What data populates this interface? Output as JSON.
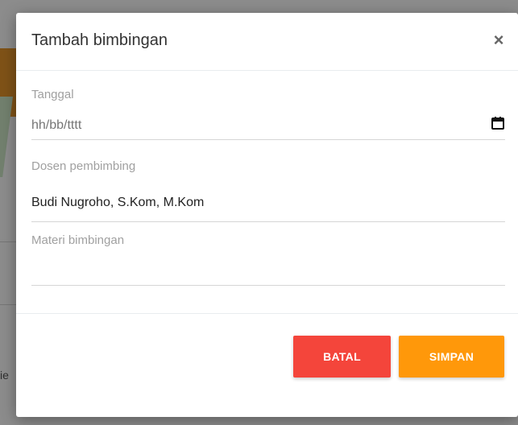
{
  "background": {
    "partial_text": "ie"
  },
  "modal": {
    "title": "Tambah bimbingan",
    "close_symbol": "×",
    "fields": {
      "tanggal": {
        "label": "Tanggal",
        "placeholder": "hh/bb/tttt",
        "value": ""
      },
      "dosen": {
        "label": "Dosen pembimbing",
        "value": "Budi Nugroho, S.Kom, M.Kom"
      },
      "materi": {
        "label": "Materi bimbingan",
        "value": ""
      }
    },
    "buttons": {
      "cancel_label": "BATAL",
      "save_label": "SIMPAN"
    }
  },
  "colors": {
    "cancel": "#f4453b",
    "save": "#ff980a",
    "accent_bg": "#e8962a"
  },
  "icons": {
    "close": "close-icon",
    "calendar": "calendar-icon"
  }
}
